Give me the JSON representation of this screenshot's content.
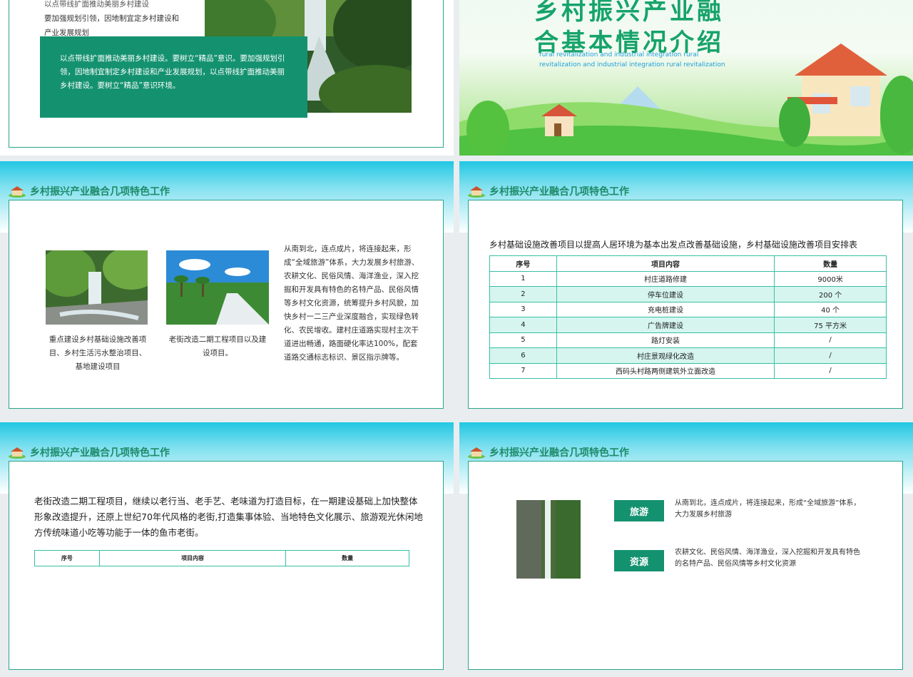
{
  "slide1": {
    "text_cut": "以点带线扩面推动美丽乡村建设",
    "text_lines": [
      "要加强规划引领，因地制宜定乡村建设和",
      "产业发展规划"
    ],
    "greenbox": "以点带线扩面推动美丽乡村建设。要树立“精品”意识。要加强规划引领，因地制宜制定乡村建设和产业发展规划，以点带线扩面推动美丽乡村建设。要树立“精品”意识环境。"
  },
  "slide2": {
    "title_line1": "乡村振兴产业融",
    "title_line2": "合基本情况介绍",
    "subtitle": "rural revitalization and industrial integration rural revitalization and industrial integration rural revitalization"
  },
  "section_header": "乡村振兴产业融合几项特色工作",
  "slide3": {
    "caption1": "重点建设乡村基础设施改善项目、乡村生活污水整治项目、基地建设项目",
    "caption2": "老街改造二期工程项目以及建设项目。",
    "body": "从南到北，连点成片，将连接起来，形成“全域旅游”体系，大力发展乡村旅游、农耕文化、民俗风情、海洋渔业，深入挖掘和开发具有特色的名特产品、民俗风情等乡村文化资源，统筹提升乡村风貌，加快乡村一二三产业深度融合，实现绿色转化、农民增收。建村庄道路实现村主次干道进出畅通，路面硬化率达100%，配套道路交通标志标识、景区指示牌等。"
  },
  "slide4": {
    "intro": "乡村基础设施改善项目以提高人居环境为基本出发点改善基础设施，乡村基础设施改善项目安排表",
    "headers": [
      "序号",
      "项目内容",
      "数量"
    ],
    "rows": [
      [
        "1",
        "村庄道路修建",
        "9000米"
      ],
      [
        "2",
        "停车位建设",
        "200 个"
      ],
      [
        "3",
        "充电桩建设",
        "40 个"
      ],
      [
        "4",
        "广告牌建设",
        "75 平方米"
      ],
      [
        "5",
        "路灯安装",
        "/"
      ],
      [
        "6",
        "村庄景观绿化改造",
        "/"
      ],
      [
        "7",
        "西码头村路两侧建筑外立面改造",
        "/"
      ]
    ]
  },
  "slide5": {
    "intro": "老街改造二期工程项目，继续以老行当、老手艺、老味道为打造目标，在一期建设基础上加快整体形象改造提升，还原上世纪70年代风格的老街,打造集事体验、当地特色文化展示、旅游观光休闲地方传统味道小吃等功能于一体的鱼市老街。",
    "headers": [
      "序号",
      "项目内容",
      "数量"
    ]
  },
  "slide6": {
    "tag1": "旅游",
    "tag1_text": "从南到北，连点成片，将连接起来，形成“全域旅游”体系，大力发展乡村旅游",
    "tag2": "资源",
    "tag2_text": "农耕文化、民俗风情、海洋渔业，深入挖掘和开发具有特色的名特产品、民俗风情等乡村文化资源"
  },
  "colors": {
    "accent": "#149270",
    "header_text": "#1d8a68",
    "table_border": "#37bfa5",
    "row_alt": "#d6f5ef",
    "title_green": "#16a36a"
  }
}
